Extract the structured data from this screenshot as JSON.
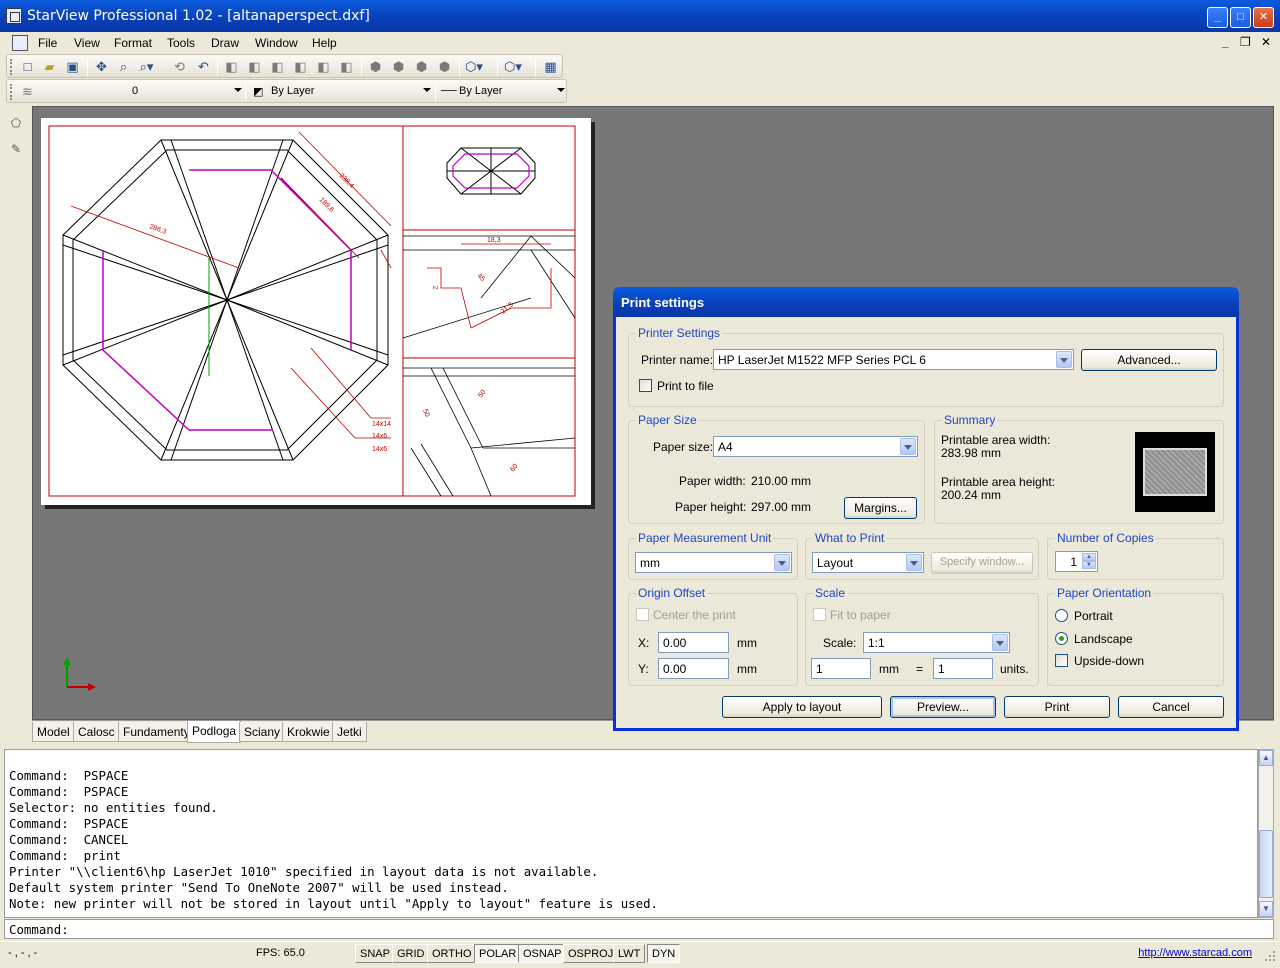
{
  "window": {
    "title": "StarView Professional 1.02 - [altanaperspect.dxf]"
  },
  "menu": {
    "items": [
      "File",
      "View",
      "Format",
      "Tools",
      "Draw",
      "Window",
      "Help"
    ]
  },
  "toolbar2": {
    "layer": "0",
    "color": "By Layer",
    "linetype": "By Layer"
  },
  "drawing": {
    "dims": [
      "286,3",
      "238,4",
      "189,6",
      "18,3",
      "21,3",
      "14x14",
      "14x6",
      "14x6",
      "45",
      "2",
      "50",
      "50",
      "60"
    ]
  },
  "tabs": [
    "Model",
    "Calosc",
    "Fundamenty",
    "Podloga",
    "Sciany",
    "Krokwie",
    "Jetki"
  ],
  "command_log": [
    "Command:  PSPACE",
    "Command:  PSPACE",
    "Selector: no entities found.",
    "Command:  PSPACE",
    "Command:  CANCEL",
    "Command:  print",
    "Printer \"\\\\client6\\hp LaserJet 1010\" specified in layout data is not available.",
    "Default system printer \"Send To OneNote 2007\" will be used instead.",
    "Note: new printer will not be stored in layout until \"Apply to layout\" feature is used."
  ],
  "command_prompt": "Command:",
  "status": {
    "coords": "- , - , -",
    "fps": "FPS: 65.0",
    "toggles": [
      "SNAP",
      "GRID",
      "ORTHO",
      "POLAR",
      "OSNAP",
      "OSPROJ",
      "LWT",
      "DYN"
    ],
    "url": "http://www.starcad.com"
  },
  "dialog": {
    "title": "Print settings",
    "printer_settings": {
      "label": "Printer Settings",
      "printer_name_label": "Printer name:",
      "printer_name": "HP LaserJet M1522 MFP Series PCL 6",
      "advanced": "Advanced...",
      "print_to_file": "Print to file"
    },
    "paper_size": {
      "label": "Paper Size",
      "size_label": "Paper size:",
      "size": "A4",
      "width_label": "Paper width:",
      "width": "210.00  mm",
      "height_label": "Paper height:",
      "height": "297.00  mm",
      "margins": "Margins..."
    },
    "summary": {
      "label": "Summary",
      "width_label": "Printable area width:",
      "width": "283.98  mm",
      "height_label": "Printable area height:",
      "height": "200.24  mm"
    },
    "unit": {
      "label": "Paper Measurement Unit",
      "value": "mm"
    },
    "what": {
      "label": "What to Print",
      "value": "Layout",
      "specify": "Specify window..."
    },
    "copies": {
      "label": "Number of Copies",
      "value": "1"
    },
    "origin": {
      "label": "Origin Offset",
      "center": "Center the print",
      "x_label": "X:",
      "x": "0.00",
      "y_label": "Y:",
      "y": "0.00",
      "unit": "mm"
    },
    "scale": {
      "label": "Scale",
      "fit": "Fit to paper",
      "scale_label": "Scale:",
      "scale": "1:1",
      "a": "1",
      "a_unit": "mm",
      "eq": "=",
      "b": "1",
      "b_unit": "units."
    },
    "orientation": {
      "label": "Paper Orientation",
      "portrait": "Portrait",
      "landscape": "Landscape",
      "upside": "Upside-down"
    },
    "buttons": {
      "apply": "Apply to layout",
      "preview": "Preview...",
      "print": "Print",
      "cancel": "Cancel"
    }
  }
}
